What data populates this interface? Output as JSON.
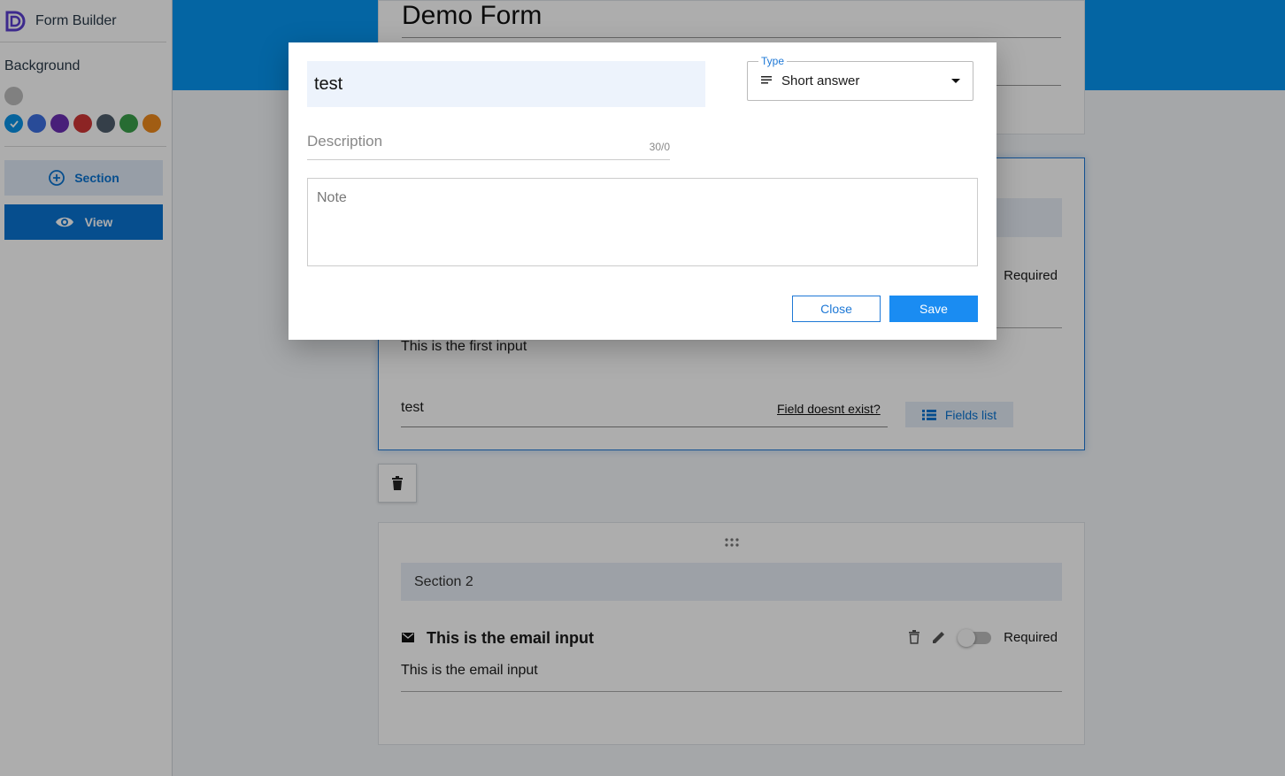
{
  "app": {
    "title": "Form Builder",
    "logo_icon": "brand-d-logo"
  },
  "sidebar": {
    "background_label": "Background",
    "swatches": [
      {
        "color": "#bdbdbd",
        "selected": false
      },
      {
        "color": "#0a93e6",
        "selected": true
      },
      {
        "color": "#3b6fe0",
        "selected": false
      },
      {
        "color": "#6a2fb3",
        "selected": false
      },
      {
        "color": "#cf3535",
        "selected": false
      },
      {
        "color": "#4e5d6c",
        "selected": false
      },
      {
        "color": "#3aa04a",
        "selected": false
      },
      {
        "color": "#ee8a1d",
        "selected": false
      }
    ],
    "section_button": "Section",
    "view_button": "View"
  },
  "form": {
    "title": "Demo Form",
    "section1": {
      "required_label": "Required",
      "field_description": "This is the first input",
      "field_value": "test",
      "missing_field_link": "Field doesnt exist?",
      "fields_list_button": "Fields list"
    },
    "section2": {
      "title": "Section 2",
      "field_title": "This is the email input",
      "field_description": "This is the email input",
      "required_label": "Required",
      "required": false
    }
  },
  "dialog": {
    "name_value": "test",
    "type_legend": "Type",
    "type_value": "Short answer",
    "description_placeholder": "Description",
    "description_counter": "30/0",
    "note_placeholder": "Note",
    "close_button": "Close",
    "save_button": "Save"
  },
  "colors": {
    "accent": "#1a8cf2",
    "banner": "#0795f0"
  }
}
